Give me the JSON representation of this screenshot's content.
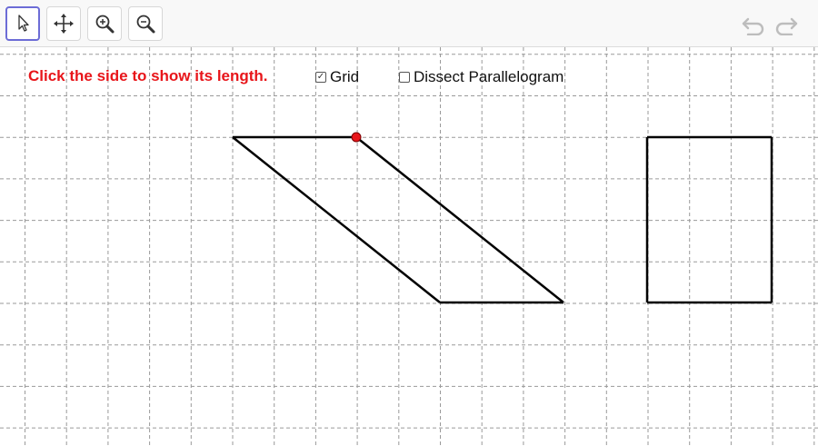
{
  "toolbar": {
    "tools": [
      {
        "id": "move",
        "icon": "arrow-pointer-icon",
        "active": true
      },
      {
        "id": "move-graphics-view",
        "icon": "move-arrows-icon",
        "active": false
      },
      {
        "id": "zoom-in",
        "icon": "zoom-in-icon",
        "active": false
      },
      {
        "id": "zoom-out",
        "icon": "zoom-out-icon",
        "active": false
      }
    ],
    "undo_icon": "undo-icon",
    "redo_icon": "redo-icon"
  },
  "instruction": "Click the side to show its length.",
  "checkboxes": {
    "grid": {
      "label": "Grid",
      "checked": true
    },
    "dissect": {
      "label": "Dissect Parallelogram",
      "checked": false
    }
  },
  "colors": {
    "instruction": "#e8151a",
    "point": "#e8151a",
    "active_tool_border": "#6c6cd6",
    "grid_line": "#9a9a9a",
    "shape_stroke": "#000000"
  }
}
